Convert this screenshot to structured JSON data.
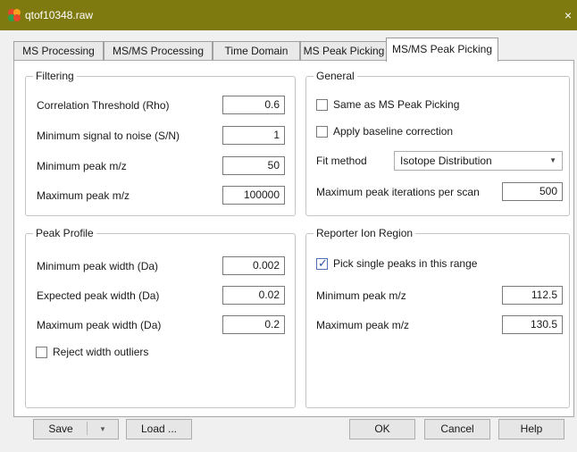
{
  "window": {
    "title": "qtof10348.raw",
    "close_glyph": "×",
    "app_icon": "app-icon"
  },
  "tabs": [
    {
      "label": "MS Processing",
      "active": false
    },
    {
      "label": "MS/MS Processing",
      "active": false
    },
    {
      "label": "Time Domain",
      "active": false
    },
    {
      "label": "MS Peak Picking",
      "active": false
    },
    {
      "label": "MS/MS Peak Picking",
      "active": true
    }
  ],
  "filtering": {
    "title": "Filtering",
    "rows": [
      {
        "label": "Correlation Threshold (Rho)",
        "value": "0.6"
      },
      {
        "label": "Minimum signal to noise (S/N)",
        "value": "1"
      },
      {
        "label": "Minimum peak m/z",
        "value": "50"
      },
      {
        "label": "Maximum peak m/z",
        "value": "100000"
      }
    ]
  },
  "general": {
    "title": "General",
    "same_as_ms": {
      "label": "Same as MS Peak Picking",
      "checked": false
    },
    "baseline": {
      "label": "Apply baseline correction",
      "checked": false
    },
    "fit_method_label": "Fit method",
    "fit_method_value": "Isotope Distribution",
    "max_iter_label": "Maximum peak iterations per scan",
    "max_iter_value": "500"
  },
  "peak_profile": {
    "title": "Peak Profile",
    "rows": [
      {
        "label": "Minimum peak width (Da)",
        "value": "0.002"
      },
      {
        "label": "Expected peak width (Da)",
        "value": "0.02"
      },
      {
        "label": "Maximum peak width (Da)",
        "value": "0.2"
      }
    ],
    "reject": {
      "label": "Reject width outliers",
      "checked": false
    }
  },
  "reporter": {
    "title": "Reporter Ion Region",
    "pick_single": {
      "label": "Pick single peaks in this range",
      "checked": true
    },
    "min_label": "Minimum peak m/z",
    "min_value": "112.5",
    "max_label": "Maximum peak m/z",
    "max_value": "130.5"
  },
  "footer": {
    "save_label": "Save",
    "save_dropdown_glyph": "▾",
    "load_label": "Load ...",
    "ok_label": "OK",
    "cancel_label": "Cancel",
    "help_label": "Help"
  },
  "colors": {
    "titlebar": "#7f7a10",
    "dialog_bg": "#f0f0f0",
    "checkbox_accent": "#2f4fa4"
  }
}
